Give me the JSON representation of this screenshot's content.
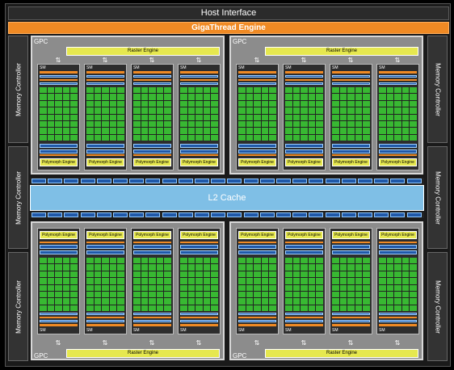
{
  "host_interface": "Host Interface",
  "gigathread": "GigaThread Engine",
  "memory_controller": "Memory Controller",
  "gpc_label": "GPC",
  "raster_engine": "Raster Engine",
  "polymorph_engine": "Polymorph Engine",
  "sm_label": "SM",
  "l2_cache": "L2 Cache"
}
